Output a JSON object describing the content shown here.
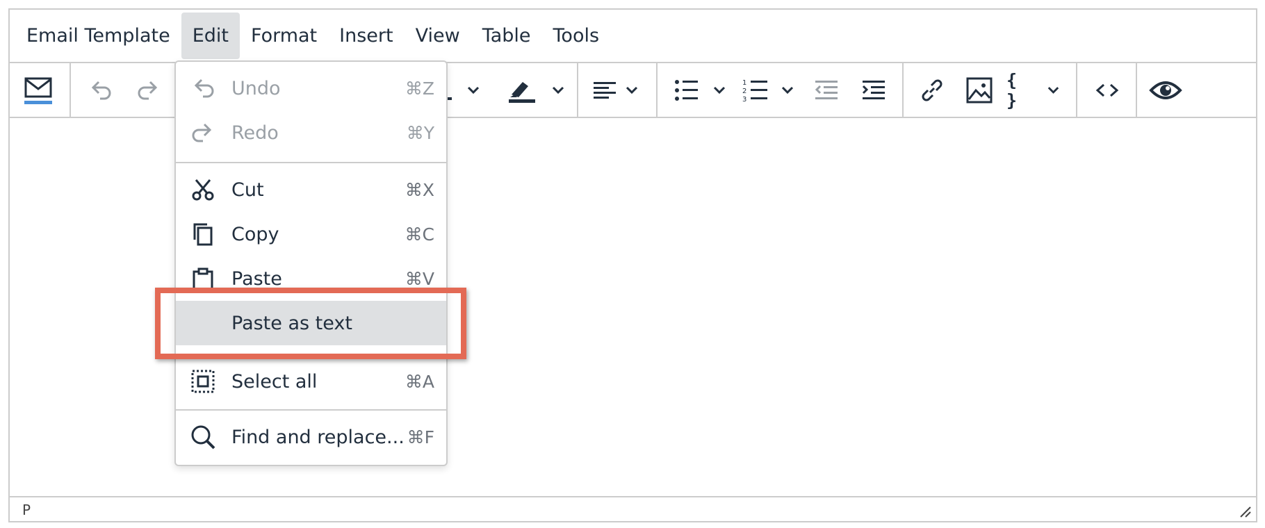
{
  "menubar": {
    "items": [
      {
        "label": "Email Template"
      },
      {
        "label": "Edit"
      },
      {
        "label": "Format"
      },
      {
        "label": "Insert"
      },
      {
        "label": "View"
      },
      {
        "label": "Table"
      },
      {
        "label": "Tools"
      }
    ],
    "active": "Edit"
  },
  "toolbar": {
    "icons": [
      "email-template-icon",
      "undo-icon",
      "redo-icon",
      "text-color-icon",
      "highlight-color-icon",
      "align-left-icon",
      "bullet-list-icon",
      "numbered-list-icon",
      "outdent-icon",
      "indent-icon",
      "link-icon",
      "image-icon",
      "merge-tags-icon",
      "source-code-icon",
      "preview-icon"
    ],
    "accent_color": "#4a90d9",
    "merge_tags_label": "{ }"
  },
  "edit_menu": {
    "items": [
      {
        "label": "Undo",
        "shortcut": "⌘Z",
        "icon": "undo-icon",
        "disabled": true
      },
      {
        "label": "Redo",
        "shortcut": "⌘Y",
        "icon": "redo-icon",
        "disabled": true
      },
      {
        "label": "Cut",
        "shortcut": "⌘X",
        "icon": "scissors-icon"
      },
      {
        "label": "Copy",
        "shortcut": "⌘C",
        "icon": "copy-icon"
      },
      {
        "label": "Paste",
        "shortcut": "⌘V",
        "icon": "clipboard-icon"
      },
      {
        "label": "Paste as text",
        "shortcut": "",
        "icon": "",
        "highlighted": true
      },
      {
        "label": "Select all",
        "shortcut": "⌘A",
        "icon": "select-all-icon"
      },
      {
        "label": "Find and replace...",
        "shortcut": "⌘F",
        "icon": "search-icon"
      }
    ]
  },
  "statusbar": {
    "path": "P"
  },
  "annotation": {
    "color": "#e36a55"
  }
}
